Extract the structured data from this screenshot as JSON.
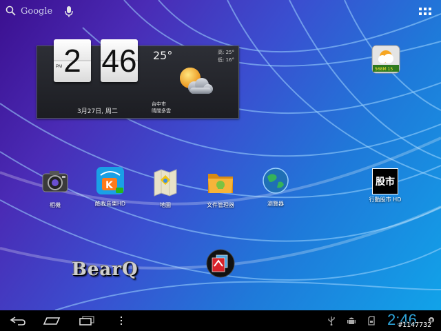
{
  "search": {
    "label": "Google"
  },
  "clock_widget": {
    "hour": "2",
    "minute": "46",
    "ampm": "PM",
    "date": "3月27日, 周二",
    "temperature": "25°",
    "high": "高: 25°",
    "low": "低: 16°",
    "city": "台中市",
    "condition": "晴間多雲"
  },
  "weather_app": {
    "badge": "568M 15"
  },
  "apps": [
    {
      "label": "相機"
    },
    {
      "label": "酷我音樂HD"
    },
    {
      "label": "地圖"
    },
    {
      "label": "文件管理器"
    },
    {
      "label": "瀏覽器"
    },
    {
      "label": "行動股市 HD"
    }
  ],
  "stock_icon_text": "股市",
  "wallpaper_logo": "BearQ",
  "status_bar": {
    "time": "2:46"
  },
  "watermark": "#1147732",
  "colors": {
    "clock_accent": "#2ea4d9",
    "navbar": "#000000"
  }
}
